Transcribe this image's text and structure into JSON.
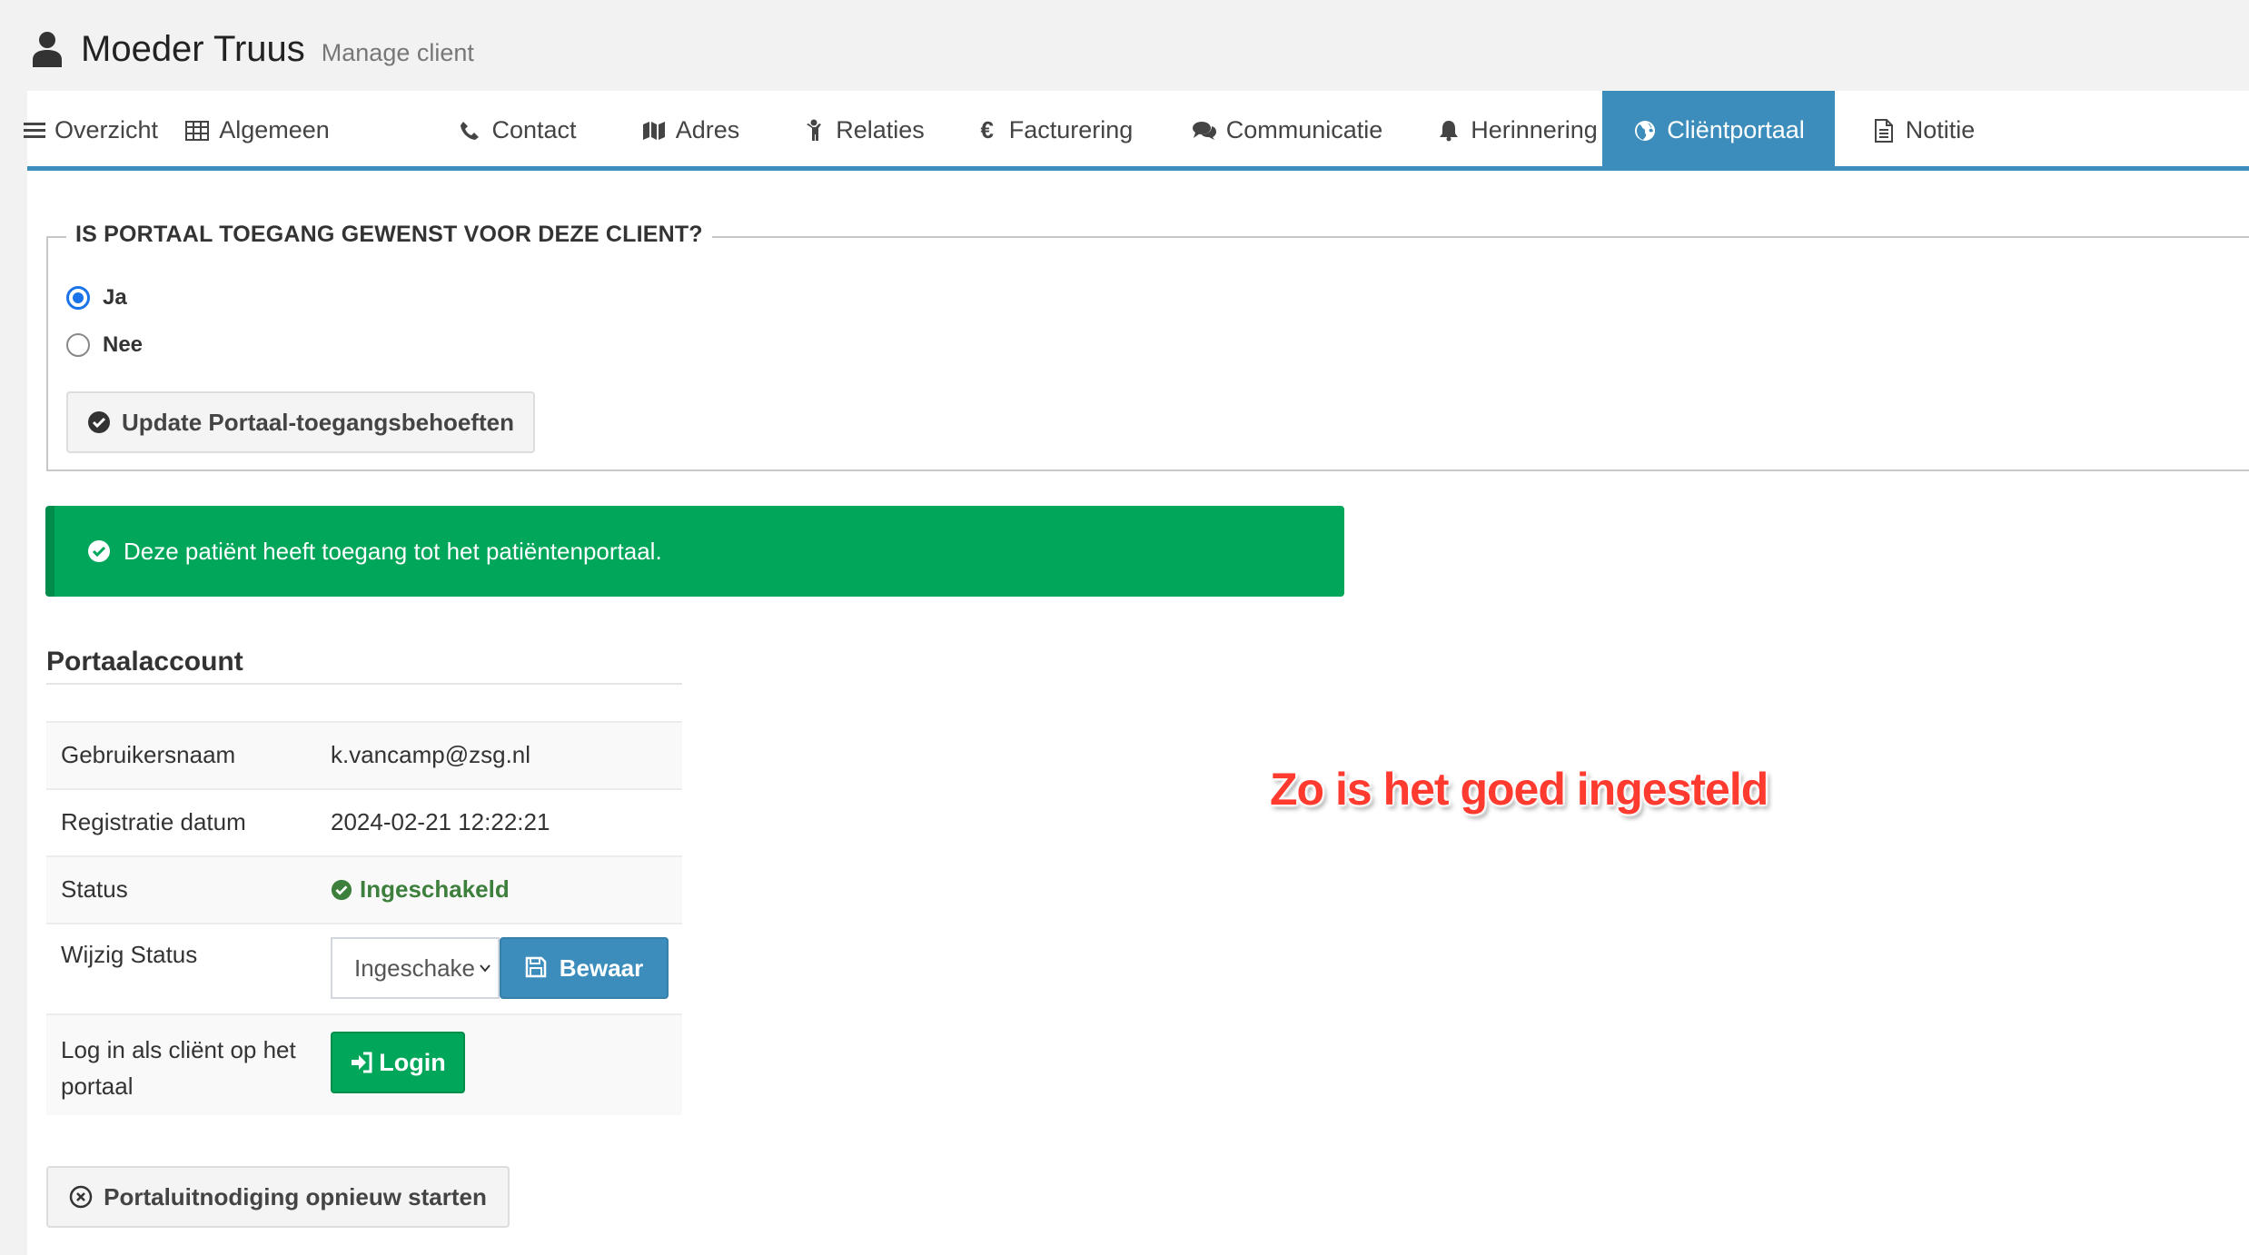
{
  "header": {
    "name": "Moeder Truus",
    "subtitle": "Manage client"
  },
  "tabs": [
    {
      "label": "Overzicht",
      "icon": "bars-icon"
    },
    {
      "label": "Algemeen",
      "icon": "table-icon"
    },
    {
      "label": "Contact",
      "icon": "phone-icon"
    },
    {
      "label": "Adres",
      "icon": "map-icon"
    },
    {
      "label": "Relaties",
      "icon": "child-icon"
    },
    {
      "label": "Facturering",
      "icon": "euro-icon"
    },
    {
      "label": "Communicatie",
      "icon": "comments-icon"
    },
    {
      "label": "Herinnering",
      "icon": "bell-icon"
    },
    {
      "label": "Cliëntportaal",
      "icon": "globe-icon",
      "active": true
    },
    {
      "label": "Notitie",
      "icon": "file-text-icon"
    }
  ],
  "portal_access": {
    "question": "IS PORTAAL TOEGANG GEWENST VOOR DEZE CLIENT?",
    "options": [
      {
        "label": "Ja",
        "checked": true
      },
      {
        "label": "Nee",
        "checked": false
      }
    ],
    "update_button": "Update Portaal-toegangsbehoeften"
  },
  "alert": {
    "message": "Deze patiënt heeft toegang tot het patiëntenportaal."
  },
  "account": {
    "title": "Portaalaccount",
    "username_label": "Gebruikersnaam",
    "username": "k.vancamp@zsg.nl",
    "registration_label": "Registratie datum",
    "registration_date": "2024-02-21 12:22:21",
    "status_label": "Status",
    "status": "Ingeschakeld",
    "change_status_label": "Wijzig Status",
    "status_select_value": "Ingeschake",
    "save_button": "Bewaar",
    "login_label_line1": "Log in als cliënt op het",
    "login_label_line2": "portaal",
    "login_button": "Login"
  },
  "restart_button": "Portaluitnodiging opnieuw starten",
  "annotation": "Zo is het goed ingesteld",
  "colors": {
    "accent": "#3c8dbc",
    "success": "#00a65a",
    "status_text": "#3d7f3d",
    "annotation": "#ff3b30"
  }
}
